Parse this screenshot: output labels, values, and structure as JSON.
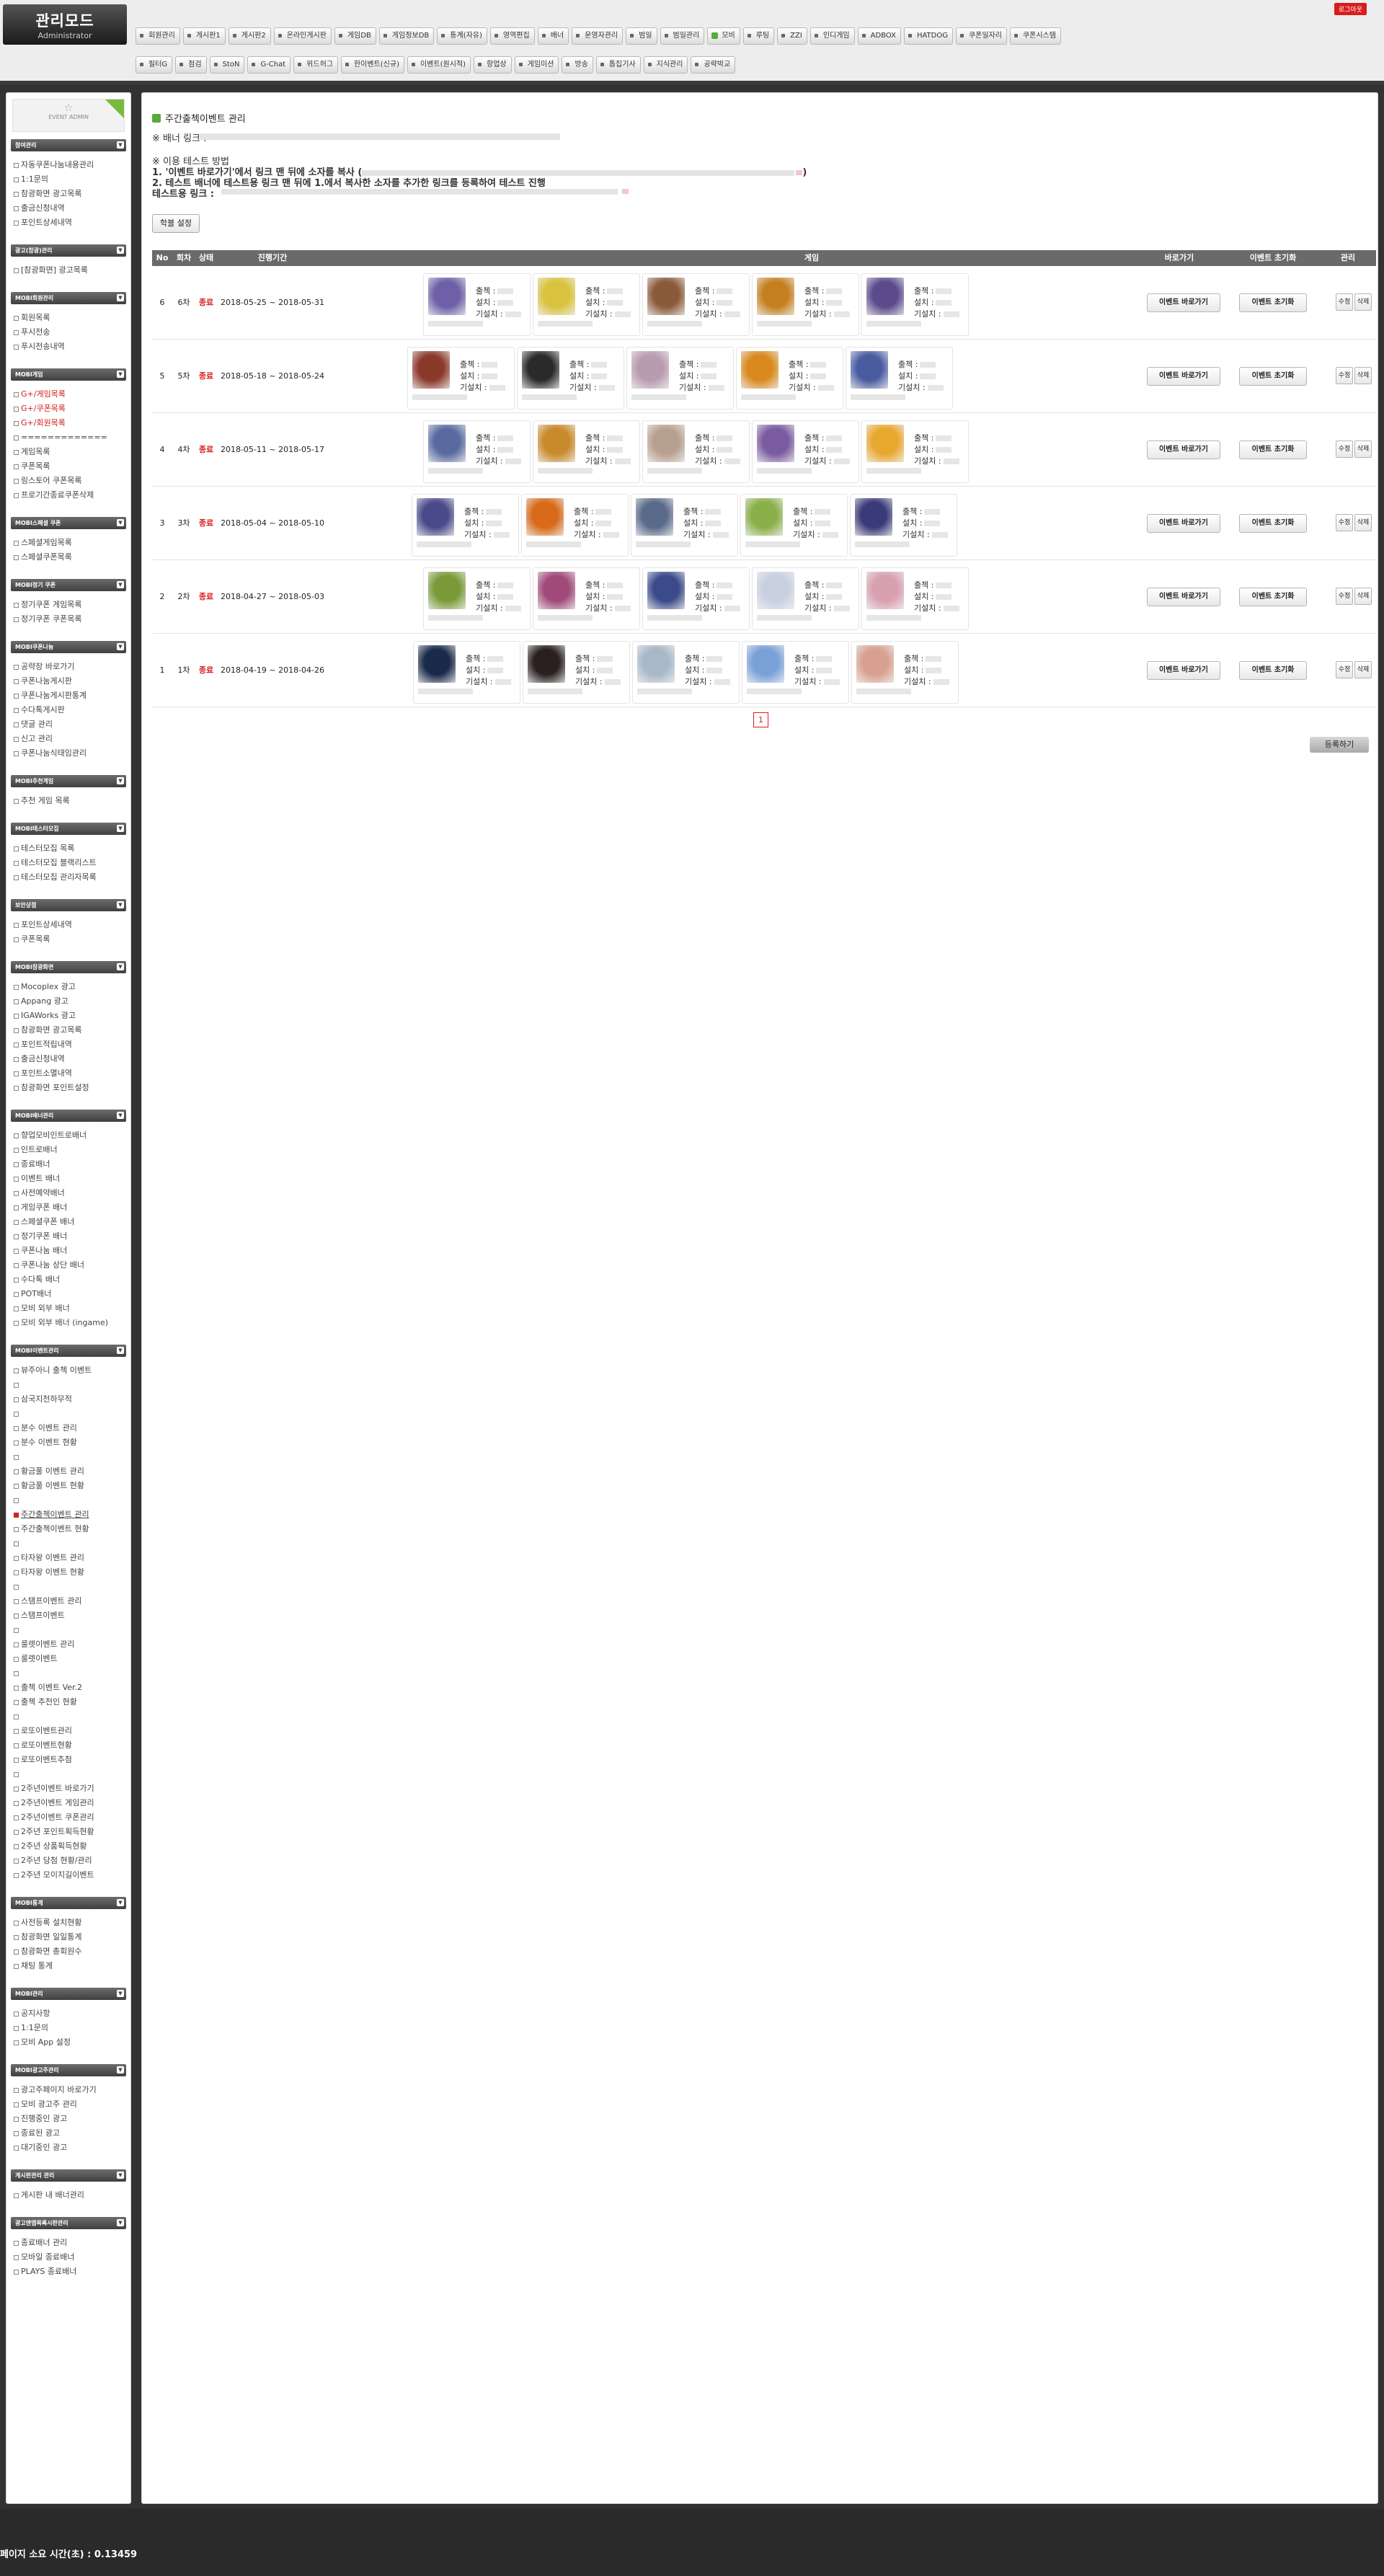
{
  "header": {
    "logo_title": "관리모드",
    "logo_sub": "Administrator",
    "logout": "로그아웃",
    "menu_row1": [
      "회원관리",
      "게시판1",
      "게시판2",
      "온라인게시판",
      "게임DB",
      "게임정보DB",
      "통계(자유)",
      "영역편집",
      "배너",
      "운영자관리",
      "범일",
      "범일관리",
      "모비",
      "루팅",
      "ZZI",
      "인디게임",
      "ADBOX",
      "HATDOG",
      "쿠폰일자리",
      "쿠폰시스템"
    ],
    "menu_row1_active": 12,
    "menu_row2": [
      "필터G",
      "점검",
      "StoN",
      "G-Chat",
      "위드허그",
      "한이벤트(신규)",
      "이벤트(원시적)",
      "항업상",
      "게임미션",
      "방송",
      "톱집기사",
      "지식관리",
      "공략박교"
    ]
  },
  "sidebar": {
    "event_admin": "EVENT ADMIN",
    "sections": [
      {
        "title": "참여관리",
        "items": [
          "자동쿠폰나눔내용관리",
          "1:1문의",
          "참광화면 광고목록",
          "출금신청내역",
          "포인트상세내역"
        ]
      },
      {
        "title": "광고(참광)관리",
        "items": [
          "[참광화면] 광고목록"
        ]
      },
      {
        "title": "MOBI회원관리",
        "items": [
          "회원목록",
          "푸시전송",
          "푸시전송내역"
        ]
      },
      {
        "title": "MOBI게임",
        "items": [
          "G+/게임목록",
          "G+/쿠폰목록",
          "G+/회원목록",
          "=============",
          "게임목록",
          "쿠폰목록",
          "링스토어 쿠폰목록",
          "프로기간종료쿠폰삭제"
        ]
      },
      {
        "title": "MOBI스페셜 쿠폰",
        "items": [
          "스페셜게임목록",
          "스페셜쿠폰목록"
        ]
      },
      {
        "title": "MOBI정기 쿠폰",
        "items": [
          "정기쿠폰 게임목록",
          "정기쿠폰 쿠폰목록"
        ]
      },
      {
        "title": "MOBI쿠폰나눔",
        "items": [
          "공략장 바로가기",
          "쿠폰나눔게시판",
          "쿠폰나눔게시판통계",
          "수다톡게시판",
          "댓글 관리",
          "신고 관리",
          "쿠폰나눔식태임관리"
        ]
      },
      {
        "title": "MOBI추천게임",
        "items": [
          "추천 게임 목록"
        ]
      },
      {
        "title": "MOBI테스터모집",
        "items": [
          "테스터모집 목록",
          "테스터모집 블랙리스트",
          "테스터모집 관리자목록"
        ]
      },
      {
        "title": "보안상점",
        "items": [
          "포인트상세내역",
          "쿠폰목록"
        ]
      },
      {
        "title": "MOBI참광화면",
        "items": [
          "Mocoplex 광고",
          "Appang 광고",
          "IGAWorks 광고",
          "참광화면 광고목록",
          "포인트적립내역",
          "출금신청내역",
          "포인트소멸내역",
          "참광화면 포인트설정"
        ]
      },
      {
        "title": "MOBI배너관리",
        "items": [
          "향업모비인트로배너",
          "인트로배너",
          "종료배너",
          "이벤트 배너",
          "사전예약배너",
          "게임쿠폰 배너",
          "스페셜쿠폰 배너",
          "정기쿠폰 배너",
          "쿠폰나눔 배너",
          "쿠폰나눔 상단 배너",
          "수다톡 배너",
          "POT배너",
          "모비 외부 배너",
          "모비 외부 배너 (ingame)"
        ]
      },
      {
        "title": "MOBI이벤트관리",
        "items": [
          "뷰주아니 출첵 이벤트",
          "",
          "삼국지천하무적",
          "",
          "분수 이벤트 관리",
          "분수 이벤트 현황",
          "",
          "황금풀 이벤트 관리",
          "황금풀 이벤트 현황",
          "",
          "주간출첵이벤트 관리",
          "주간출첵이벤트 현황",
          "",
          "타자왕 이벤트 관리",
          "타자왕 이벤트 현황",
          "",
          "스탬프이벤트 관리",
          "스탬프이벤트",
          "",
          "룰렛이벤트 관리",
          "룰렛이벤트",
          "",
          "출첵 이벤트 Ver.2",
          "출첵 추천인 현황",
          "",
          "로또이벤트관리",
          "로또이벤트현황",
          "로또이벤트추첨",
          "",
          "2주년이벤트 바로가기",
          "2주년이벤트 게임관리",
          "2주년이벤트 쿠폰관리",
          "2주년 포인트획득현황",
          "2주년 상품획득현황",
          "2주년 당첨 현황/관리",
          "2주년 모이지길이벤트"
        ]
      },
      {
        "title": "MOBI통계",
        "items": [
          "사전등록 설치현황",
          "참광화면 일일통계",
          "참광화면 총회원수",
          "채팅 통계"
        ]
      },
      {
        "title": "MOBI관리",
        "items": [
          "공지사항",
          "1:1문의",
          "모비 App 설정"
        ]
      },
      {
        "title": "MOBI광고주관리",
        "items": [
          "광고주페이지 바로가기",
          "모비 광고주 관리",
          "진행중인 광고",
          "종료된 광고",
          "대기중인 광고"
        ]
      },
      {
        "title": "게시판관리 관리",
        "items": [
          "게시판 내 배너관리"
        ]
      },
      {
        "title": "광고엔앱목록시판관리",
        "items": [
          "종료배너 관리",
          "모바일 종료배너",
          "PLAYS 종료배너"
        ]
      }
    ]
  },
  "main": {
    "title": "주간출첵이벤트 관리",
    "banner_label": "※ 배너 링크 :",
    "guide_title": "※ 이용 테스트 방법",
    "guide_step1": "1. '이벤트 바로가기'에서 링크 맨 뒤에 소자를 복사 (",
    "guide_step1_end": ")",
    "guide_step2": "2. 테스트 배너에 테스트용 링크 맨 뒤에 1.에서 복사한 소자를 추가한 링크를 등록하여 테스트 진행",
    "test_label": "테스트용 링크 :",
    "order_button": "학블 설정",
    "columns": [
      "No",
      "회차",
      "상태",
      "진행기간",
      "게임",
      "바로가기",
      "이벤트 초기화",
      "관리"
    ],
    "game_fields": [
      "출첵 :",
      "설치 :",
      "기설치 :"
    ],
    "link_label": "이벤트 바로가기",
    "reset_label": "이벤트 초기화",
    "edit_label": "수정",
    "delete_label": "삭제",
    "rows": [
      {
        "no": "6",
        "round": "6차",
        "status": "종료",
        "period": "2018-05-25 ~ 2018-05-31"
      },
      {
        "no": "5",
        "round": "5차",
        "status": "종료",
        "period": "2018-05-18 ~ 2018-05-24"
      },
      {
        "no": "4",
        "round": "4차",
        "status": "종료",
        "period": "2018-05-11 ~ 2018-05-17"
      },
      {
        "no": "3",
        "round": "3차",
        "status": "종료",
        "period": "2018-05-04 ~ 2018-05-10"
      },
      {
        "no": "2",
        "round": "2차",
        "status": "종료",
        "period": "2018-04-27 ~ 2018-05-03"
      },
      {
        "no": "1",
        "round": "1차",
        "status": "종료",
        "period": "2018-04-19 ~ 2018-04-26"
      }
    ],
    "page": "1",
    "register_button": "등록하기"
  },
  "footer": {
    "load_time": "페이지 소요 시간(초) : 0.13459"
  },
  "colors": {
    "status_red": "#d62020",
    "active_green": "#58a93f",
    "header_dark": "#6a6a6a"
  },
  "thumb_colors": [
    [
      "#6d5fa8",
      "#d8c23e",
      "#8a5a3a",
      "#c4801e",
      "#5b4b8d"
    ],
    [
      "#8a3a2a",
      "#2a2a2a",
      "#b89bb0",
      "#d88a1e",
      "#4a5ca0"
    ],
    [
      "#5a6aa0",
      "#c88a2a",
      "#b8a090",
      "#7a5aa0",
      "#e8a830"
    ],
    [
      "#4a4a8a",
      "#d86a1a",
      "#5a6a8a",
      "#8ab04a",
      "#3a3a7a"
    ],
    [
      "#7a9a3a",
      "#a04a7a",
      "#3a4a8a",
      "#c8d0e0",
      "#d8a0b0"
    ],
    [
      "#1a2a4a",
      "#2a2020",
      "#a8b8c8",
      "#7aa0d8",
      "#d8a090"
    ]
  ]
}
